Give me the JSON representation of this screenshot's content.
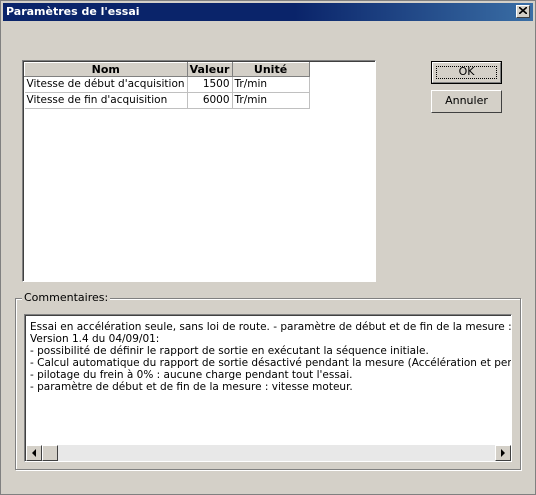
{
  "window": {
    "title": "Paramètres de l'essai"
  },
  "table": {
    "columns": [
      "Nom",
      "Valeur",
      "Unité"
    ],
    "rows": [
      {
        "name": "Vitesse de début d'acquisition",
        "value": "1500",
        "unit": "Tr/min"
      },
      {
        "name": "Vitesse de fin d'acquisition",
        "value": "6000",
        "unit": "Tr/min"
      }
    ]
  },
  "buttons": {
    "ok": "OK",
    "cancel": "Annuler"
  },
  "comments": {
    "label": "Commentaires:",
    "lines": [
      "Essai en accélération seule, sans loi de route. - paramètre de début et de fin de la mesure : vitesse",
      "Version 1.4 du 04/09/01:",
      "- possibilité de définir le rapport de sortie en exécutant la séquence initiale.",
      "- Calcul automatique du rapport de sortie désactivé pendant la mesure (Accélération et pertes)",
      "- pilotage du frein à 0% : aucune charge pendant tout l'essai.",
      "- paramètre de début et de fin de la mesure : vitesse moteur."
    ]
  },
  "icons": {
    "close": "close-icon",
    "scroll_left": "arrow-left-icon",
    "scroll_right": "arrow-right-icon"
  }
}
